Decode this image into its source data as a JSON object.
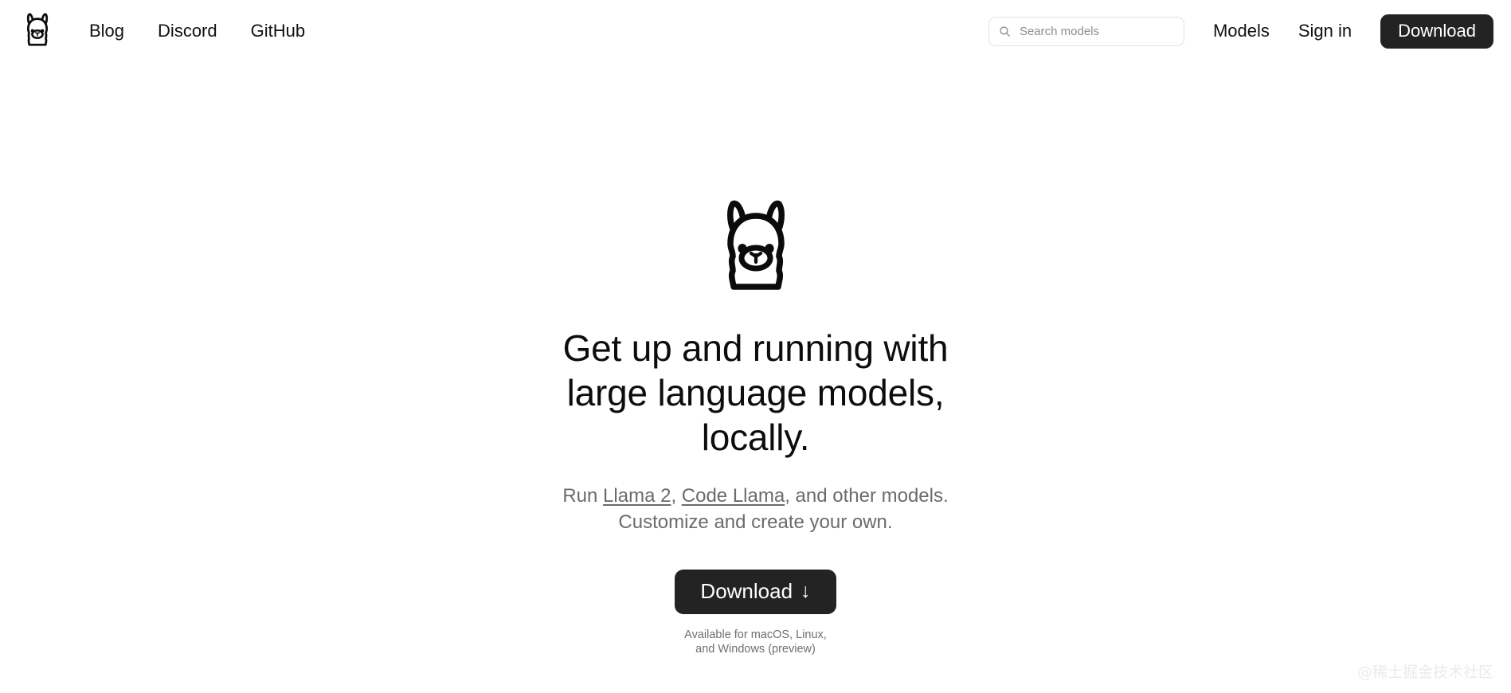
{
  "header": {
    "logo_icon": "llama-logo-icon",
    "nav": [
      {
        "label": "Blog"
      },
      {
        "label": "Discord"
      },
      {
        "label": "GitHub"
      }
    ],
    "search": {
      "icon": "search-icon",
      "placeholder": "Search models",
      "value": ""
    },
    "models_label": "Models",
    "signin_label": "Sign in",
    "download_label": "Download"
  },
  "hero": {
    "logo_icon": "llama-logo-icon",
    "title": "Get up and running with large language models, locally.",
    "subtitle": {
      "run_prefix": "Run ",
      "link_llama2": "Llama 2",
      "separator": ", ",
      "link_codellama": "Code Llama",
      "suffix": ", and other models.",
      "line2": "Customize and create your own."
    },
    "download_label": "Download",
    "download_arrow": "↓",
    "caption_line1": "Available for macOS, Linux,",
    "caption_line2": "and Windows (preview)"
  },
  "watermark": {
    "text": "@稀土掘金技术社区"
  },
  "colors": {
    "background": "#ffffff",
    "text": "#101010",
    "muted": "#6b6b6b",
    "button_dark": "#232323",
    "border": "#e3e3e3",
    "watermark": "#ebebeb"
  }
}
